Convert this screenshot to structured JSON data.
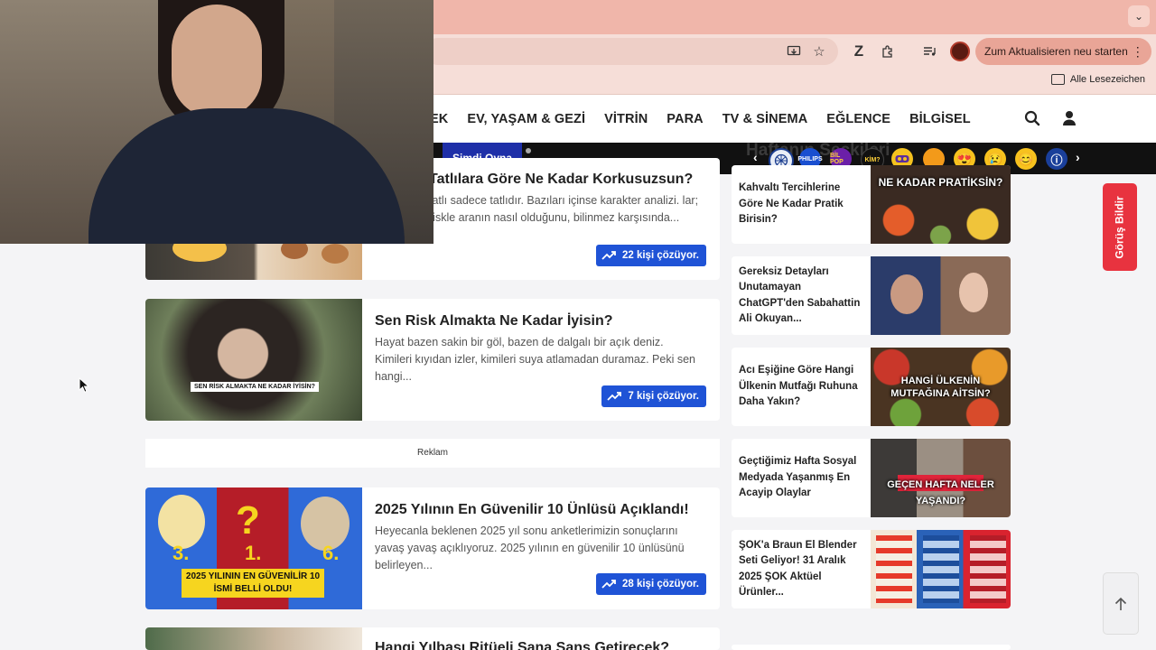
{
  "browser": {
    "update_button": "Zum Aktualisieren neu starten",
    "bookmarks_all": "Alle Lesezeichen"
  },
  "nav": {
    "items": [
      "EK",
      "EV, YAŞAM & GEZİ",
      "VİTRİN",
      "PARA",
      "TV & SİNEMA",
      "EĞLENCE",
      "BİLGİSEL"
    ]
  },
  "strip": {
    "play_label": "Şimdi Oyna",
    "background_heading": "Haftanın Seçkileri",
    "icons": [
      "globe-icon",
      "philips-icon",
      "bilpop-icon",
      "kimo-icon",
      "vr-icon",
      "orange-icon",
      "heart-eyes-emoji",
      "sad-emoji",
      "smile-emoji",
      "info-icon"
    ]
  },
  "main": {
    "cards": [
      {
        "title": "Tatlılara Göre Ne Kadar Korkusuzsun?",
        "excerpt": "tatlı sadece tatlıdır. Bazıları içinse karakter analizi. lar; riskle aranın nasıl olduğunu, bilinmez karşısında...",
        "badge": "22 kişi çözüyor."
      },
      {
        "title": "Sen Risk Almakta Ne Kadar İyisin?",
        "excerpt": "Hayat bazen sakin bir göl, bazen de dalgalı bir açık deniz. Kimileri kıyıdan izler, kimileri suya atlamadan duramaz. Peki sen hangi...",
        "badge": "7 kişi çözüyor.",
        "thumb_caption": "SEN RİSK ALMAKTA NE KADAR İYİSİN?"
      },
      {
        "title": "2025 Yılının En Güvenilir 10 Ünlüsü Açıklandı!",
        "excerpt": "Heyecanla beklenen 2025 yıl sonu anketlerimizin sonuçlarını yavaş yavaş açıklıyoruz. 2025 yılının en güvenilir 10 ünlüsünü belirleyen...",
        "badge": "28 kişi çözüyor.",
        "thumb_line1": "2025 YILININ EN GÜVENİLİR 10",
        "thumb_line2": "İSMİ BELLİ OLDU!",
        "thumb_numbers": [
          "3.",
          "1.",
          "6."
        ]
      },
      {
        "title": "Hangi Yılbaşı Ritüeli Sana Şans Getirecek?"
      }
    ],
    "ad_label": "Reklam"
  },
  "sidebar": {
    "items": [
      {
        "title": "Kahvaltı Tercihlerine Göre Ne Kadar Pratik Birisin?",
        "thumb_text": "NE KADAR PRATİKSİN?"
      },
      {
        "title": "Gereksiz Detayları Unutamayan ChatGPT'den Sabahattin Ali Okuyan...",
        "thumb_text": ""
      },
      {
        "title": "Acı Eşiğine Göre Hangi Ülkenin Mutfağı Ruhuna Daha Yakın?",
        "thumb_text": "HANGİ ÜLKENİN MUTFAĞINA AİTSİN?"
      },
      {
        "title": "Geçtiğimiz Hafta Sosyal Medyada Yaşanmış En Acayip Olaylar",
        "thumb_text": "GEÇEN HAFTA NELER YAŞANDI?"
      },
      {
        "title": "ŞOK'a Braun El Blender Seti Geliyor! 31 Aralık 2025 ŞOK Aktüel Ürünler...",
        "thumb_text": ""
      }
    ]
  },
  "feedback_label": "Görüş Bildir"
}
